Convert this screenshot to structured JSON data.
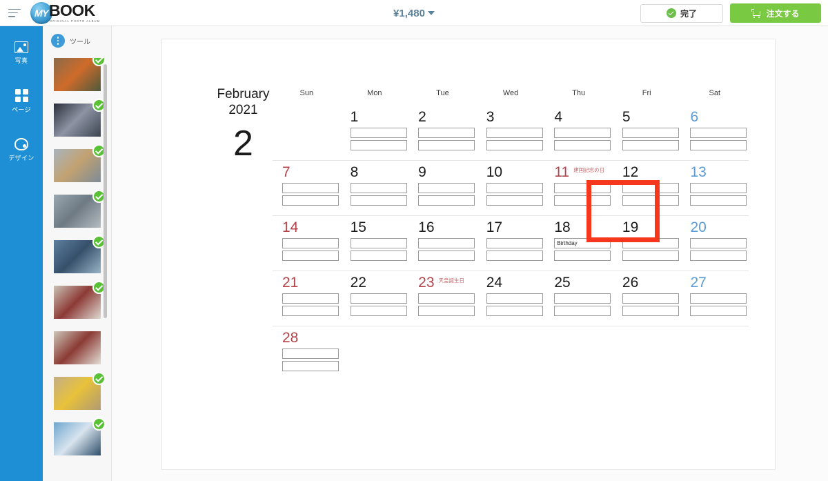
{
  "topbar": {
    "menu_icon": "hamburger-icon",
    "logo_badge": "MY",
    "logo_main": "BOOK",
    "logo_sub": "ORIGINAL PHOTO ALBUM",
    "price": "¥1,480",
    "done_label": "完了",
    "order_label": "注文する"
  },
  "rail": {
    "items": [
      {
        "label": "写真",
        "icon": "photo-icon"
      },
      {
        "label": "ページ",
        "icon": "grid-icon"
      },
      {
        "label": "デザイン",
        "icon": "palette-icon"
      }
    ]
  },
  "toolpanel": {
    "title": "ツール",
    "icon": "three-dots-icon",
    "thumbnails": [
      {
        "selected": true,
        "colors": [
          "#8a6b4a",
          "#cf6b2a",
          "#4e5a3d"
        ]
      },
      {
        "selected": true,
        "colors": [
          "#2b2f3a",
          "#8d93a3",
          "#3c4450"
        ]
      },
      {
        "selected": true,
        "colors": [
          "#a8b4bd",
          "#c3a271",
          "#7c8b96"
        ]
      },
      {
        "selected": true,
        "colors": [
          "#9aa7b0",
          "#6e7a83",
          "#b5bcc2"
        ]
      },
      {
        "selected": true,
        "colors": [
          "#5d7f9e",
          "#36506b",
          "#98b2c6"
        ]
      },
      {
        "selected": true,
        "colors": [
          "#c9c2b6",
          "#8d3a36",
          "#ded9d1"
        ]
      },
      {
        "selected": false,
        "colors": [
          "#cdc6ba",
          "#8a3b34",
          "#e3ded6"
        ]
      },
      {
        "selected": true,
        "colors": [
          "#c4ae86",
          "#e8c23a",
          "#b09a72"
        ]
      },
      {
        "selected": true,
        "colors": [
          "#6fa6cf",
          "#d8e4ee",
          "#2f4f6b"
        ]
      }
    ]
  },
  "calendar": {
    "month_name": "February",
    "year": "2021",
    "month_number": "2",
    "dow": [
      "Sun",
      "Mon",
      "Tue",
      "Wed",
      "Thu",
      "Fri",
      "Sat"
    ],
    "weeks": [
      [
        {
          "day": "",
          "kind": "empty",
          "slots": []
        },
        {
          "day": "1",
          "kind": "weekday",
          "slots": [
            "",
            ""
          ]
        },
        {
          "day": "2",
          "kind": "weekday",
          "slots": [
            "",
            ""
          ]
        },
        {
          "day": "3",
          "kind": "weekday",
          "slots": [
            "",
            ""
          ]
        },
        {
          "day": "4",
          "kind": "weekday",
          "slots": [
            "",
            ""
          ]
        },
        {
          "day": "5",
          "kind": "weekday",
          "slots": [
            "",
            ""
          ]
        },
        {
          "day": "6",
          "kind": "sat",
          "slots": [
            "",
            ""
          ]
        }
      ],
      [
        {
          "day": "7",
          "kind": "sun",
          "slots": [
            "",
            ""
          ]
        },
        {
          "day": "8",
          "kind": "weekday",
          "slots": [
            "",
            ""
          ]
        },
        {
          "day": "9",
          "kind": "weekday",
          "slots": [
            "",
            ""
          ]
        },
        {
          "day": "10",
          "kind": "weekday",
          "slots": [
            "",
            ""
          ]
        },
        {
          "day": "11",
          "kind": "sun",
          "holiday": "建国記念の日",
          "slots": [
            "",
            ""
          ]
        },
        {
          "day": "12",
          "kind": "weekday",
          "slots": [
            "",
            ""
          ]
        },
        {
          "day": "13",
          "kind": "sat",
          "slots": [
            "",
            ""
          ]
        }
      ],
      [
        {
          "day": "14",
          "kind": "sun",
          "slots": [
            "",
            ""
          ]
        },
        {
          "day": "15",
          "kind": "weekday",
          "slots": [
            "",
            ""
          ]
        },
        {
          "day": "16",
          "kind": "weekday",
          "slots": [
            "",
            ""
          ]
        },
        {
          "day": "17",
          "kind": "weekday",
          "slots": [
            "",
            ""
          ]
        },
        {
          "day": "18",
          "kind": "weekday",
          "slots": [
            "Birthday",
            ""
          ],
          "selected": true
        },
        {
          "day": "19",
          "kind": "weekday",
          "slots": [
            "",
            ""
          ]
        },
        {
          "day": "20",
          "kind": "sat",
          "slots": [
            "",
            ""
          ]
        }
      ],
      [
        {
          "day": "21",
          "kind": "sun",
          "slots": [
            "",
            ""
          ]
        },
        {
          "day": "22",
          "kind": "weekday",
          "slots": [
            "",
            ""
          ]
        },
        {
          "day": "23",
          "kind": "sun",
          "holiday": "天皇誕生日",
          "slots": [
            "",
            ""
          ]
        },
        {
          "day": "24",
          "kind": "weekday",
          "slots": [
            "",
            ""
          ]
        },
        {
          "day": "25",
          "kind": "weekday",
          "slots": [
            "",
            ""
          ]
        },
        {
          "day": "26",
          "kind": "weekday",
          "slots": [
            "",
            ""
          ]
        },
        {
          "day": "27",
          "kind": "sat",
          "slots": [
            "",
            ""
          ]
        }
      ],
      [
        {
          "day": "28",
          "kind": "sun",
          "slots": [
            "",
            ""
          ]
        },
        {
          "day": "",
          "kind": "empty",
          "slots": []
        },
        {
          "day": "",
          "kind": "empty",
          "slots": []
        },
        {
          "day": "",
          "kind": "empty",
          "slots": []
        },
        {
          "day": "",
          "kind": "empty",
          "slots": []
        },
        {
          "day": "",
          "kind": "empty",
          "slots": []
        },
        {
          "day": "",
          "kind": "empty",
          "slots": []
        }
      ]
    ]
  },
  "colors": {
    "brand_blue": "#1e8fd5",
    "order_green": "#7ac943",
    "check_green": "#59c135",
    "sunday_red": "#b5444a",
    "saturday_blue": "#5b9bd5",
    "highlight_red": "#f4371d",
    "price_text": "#5a8299"
  }
}
